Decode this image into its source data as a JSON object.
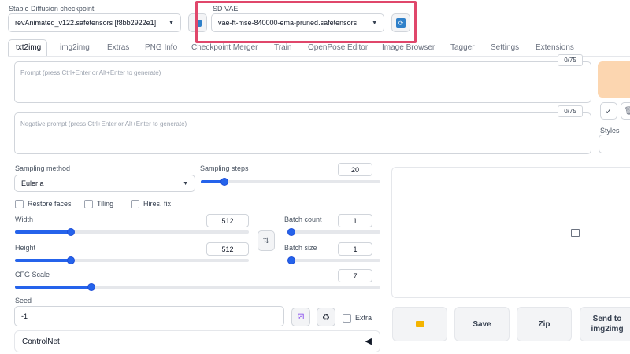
{
  "checkpoint": {
    "label": "Stable Diffusion checkpoint",
    "value": "revAnimated_v122.safetensors [f8bb2922e1]"
  },
  "vae": {
    "label": "SD VAE",
    "value": "vae-ft-mse-840000-ema-pruned.safetensors"
  },
  "colors": {
    "accent": "#2563eb",
    "highlight": "#e0476b",
    "generate": "#fcd6b0"
  },
  "tabs": [
    "txt2img",
    "img2img",
    "Extras",
    "PNG Info",
    "Checkpoint Merger",
    "Train",
    "OpenPose Editor",
    "Image Browser",
    "Tagger",
    "Settings",
    "Extensions"
  ],
  "prompt": {
    "placeholder": "Prompt (press Ctrl+Enter or Alt+Enter to generate)",
    "counter": "0/75"
  },
  "negative_prompt": {
    "placeholder": "Negative prompt (press Ctrl+Enter or Alt+Enter to generate)",
    "counter": "0/75"
  },
  "styles_label": "Styles",
  "sampling": {
    "method_label": "Sampling method",
    "method_value": "Euler a",
    "steps_label": "Sampling steps",
    "steps_value": "20",
    "steps_fraction": 0.13
  },
  "options": {
    "restore_faces": "Restore faces",
    "tiling": "Tiling",
    "hires_fix": "Hires. fix"
  },
  "width": {
    "label": "Width",
    "value": "512",
    "fraction": 0.24
  },
  "height": {
    "label": "Height",
    "value": "512",
    "fraction": 0.24
  },
  "batch_count": {
    "label": "Batch count",
    "value": "1",
    "fraction": 0.0
  },
  "batch_size": {
    "label": "Batch size",
    "value": "1",
    "fraction": 0.0
  },
  "cfg": {
    "label": "CFG Scale",
    "value": "7",
    "fraction": 0.21
  },
  "seed": {
    "label": "Seed",
    "value": "-1",
    "extra_label": "Extra"
  },
  "controlnet": {
    "label": "ControlNet"
  },
  "actions": {
    "save": "Save",
    "zip": "Zip",
    "send_to_img2img": "Send to img2img"
  }
}
